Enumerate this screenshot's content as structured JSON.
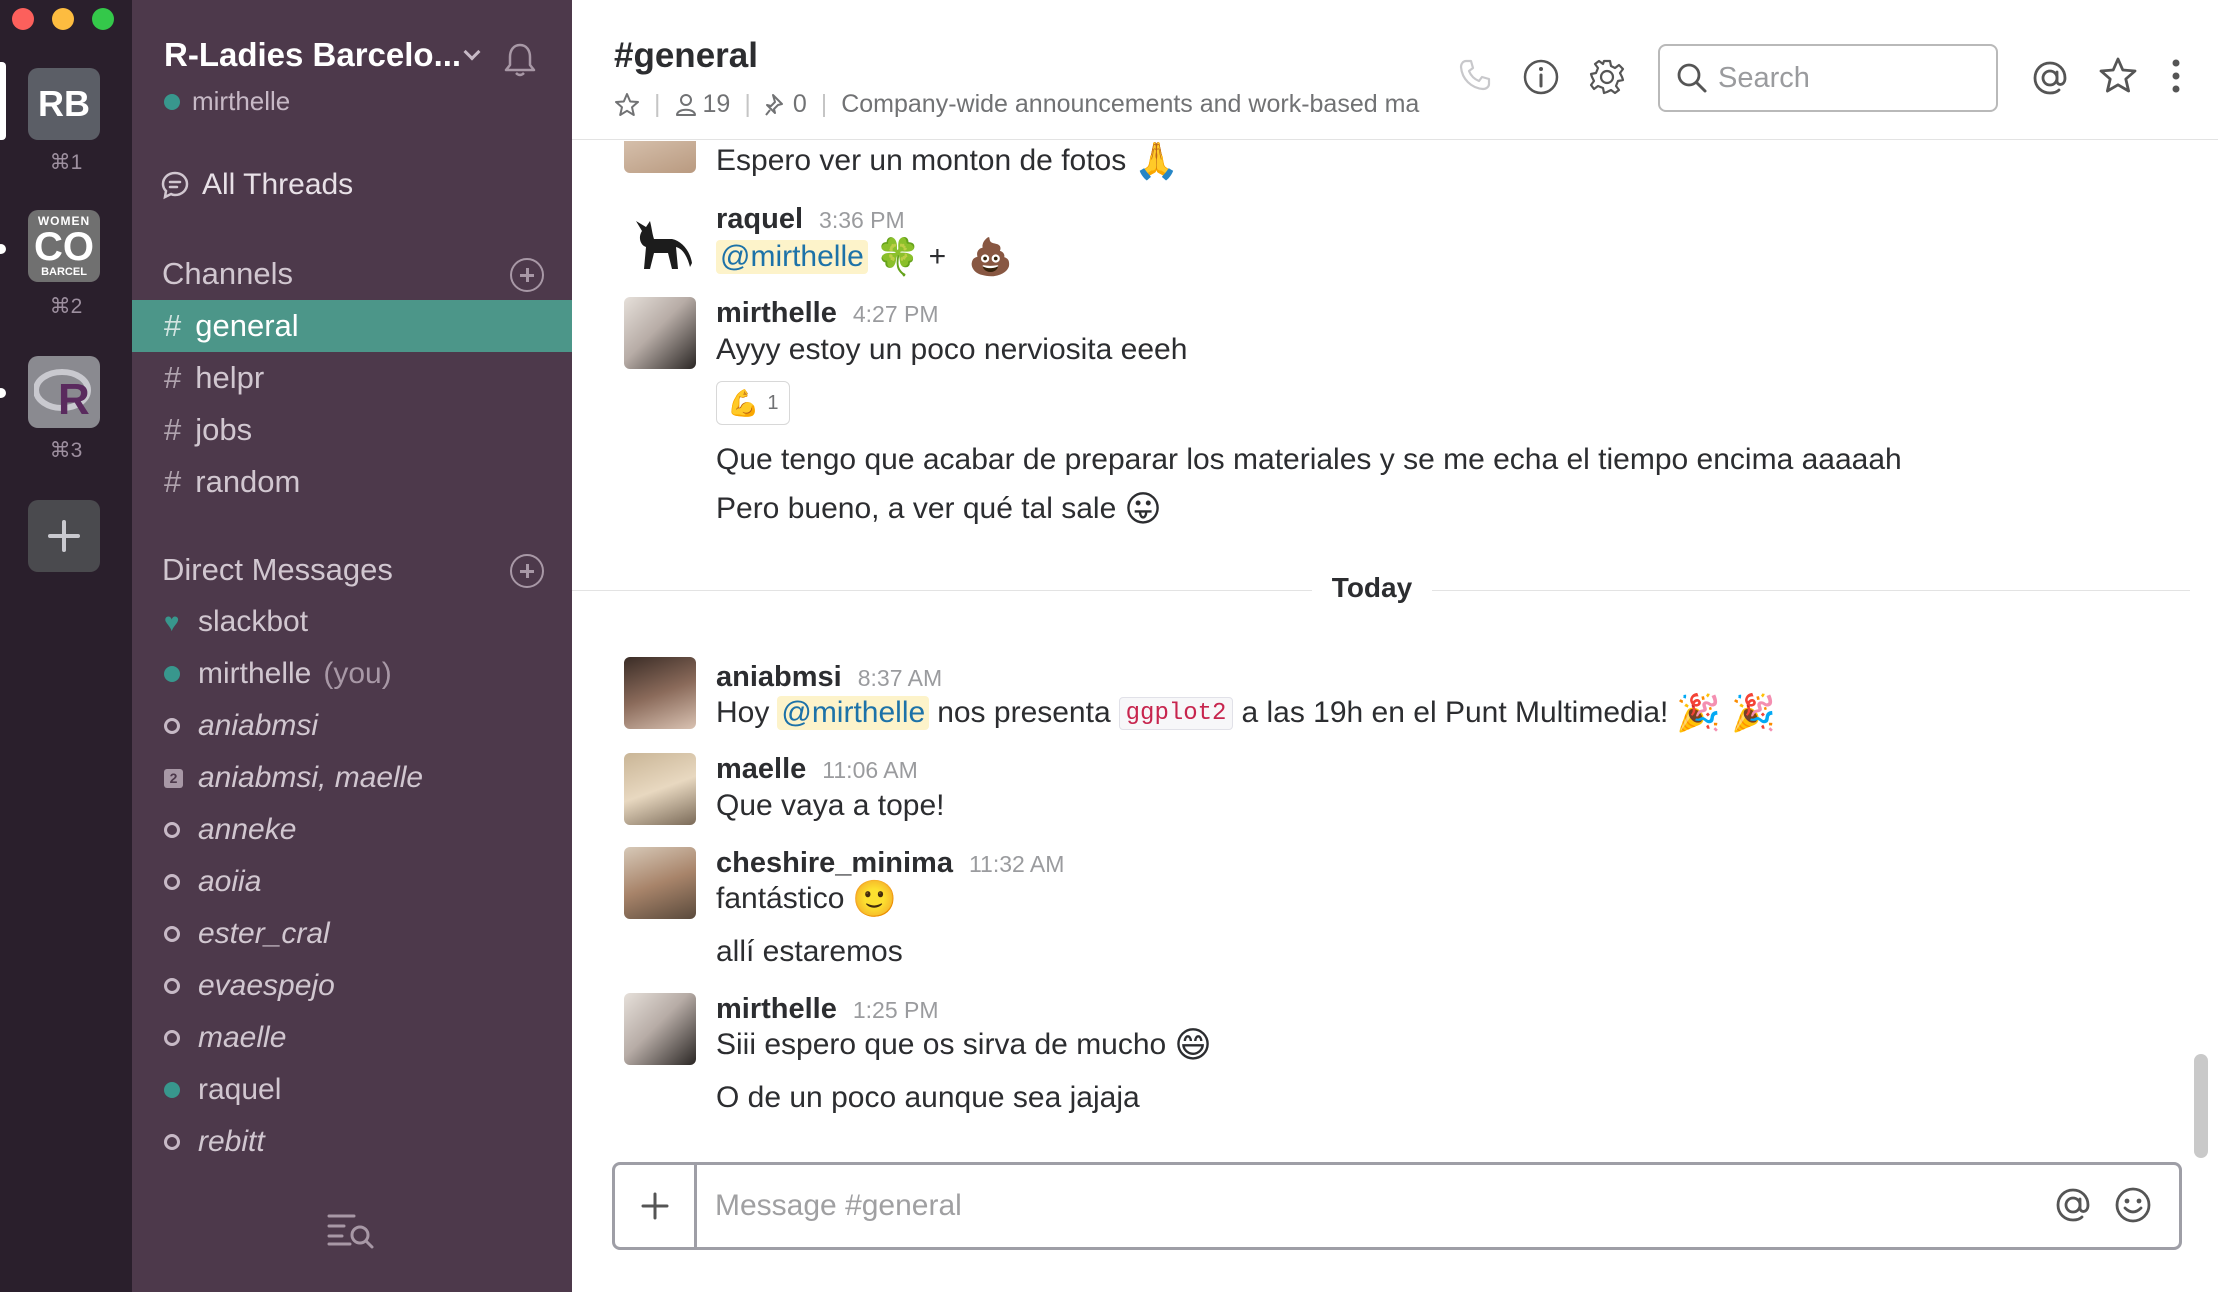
{
  "window": {
    "controls": [
      "close",
      "minimize",
      "zoom"
    ]
  },
  "workspaces": [
    {
      "label": "RB",
      "shortcut": "⌘1",
      "color": "#5b5e66",
      "active": true
    },
    {
      "label": "WOMEN CO BARCEL",
      "shortcut": "⌘2",
      "color": "#6b6b6b",
      "active": false
    },
    {
      "label": "R",
      "shortcut": "⌘3",
      "color": "#8a8a90",
      "active": false
    }
  ],
  "sidebar": {
    "team_name": "R-Ladies Barcelo...",
    "current_user": "mirthelle",
    "all_threads": "All Threads",
    "channels_heading": "Channels",
    "channels": [
      {
        "name": "general",
        "active": true
      },
      {
        "name": "helpr",
        "active": false
      },
      {
        "name": "jobs",
        "active": false
      },
      {
        "name": "random",
        "active": false
      }
    ],
    "dm_heading": "Direct Messages",
    "direct_messages": [
      {
        "name": "slackbot",
        "status": "bot"
      },
      {
        "name": "mirthelle",
        "suffix": "(you)",
        "status": "online"
      },
      {
        "name": "aniabmsi",
        "status": "away"
      },
      {
        "name": "aniabmsi, maelle",
        "status": "group",
        "count": "2"
      },
      {
        "name": "anneke",
        "status": "away"
      },
      {
        "name": "aoiia",
        "status": "away"
      },
      {
        "name": "ester_cral",
        "status": "away"
      },
      {
        "name": "evaespejo",
        "status": "away"
      },
      {
        "name": "maelle",
        "status": "away"
      },
      {
        "name": "raquel",
        "status": "online"
      },
      {
        "name": "rebitt",
        "status": "away"
      }
    ]
  },
  "header": {
    "channel": "#general",
    "members": "19",
    "pinned": "0",
    "topic": "Company-wide announcements and work-based ma",
    "search_placeholder": "Search"
  },
  "messages": {
    "m0": {
      "text": "Espero ver un monton de fotos",
      "emoji": "🙏"
    },
    "m1": {
      "author": "raquel",
      "time": "3:36 PM",
      "mention": "@mirthelle",
      "emoji1": "🍀",
      "plus": "+",
      "emoji2": "💩"
    },
    "m2": {
      "author": "mirthelle",
      "time": "4:27 PM",
      "text": "Ayyy estoy un poco nerviosita eeeh",
      "reaction_emoji": "💪",
      "reaction_count": "1",
      "text2": "Que tengo que acabar de preparar los materiales y se me echa el tiempo encima aaaaah",
      "text3": "Pero bueno, a ver qué tal sale",
      "emoji3": "😛"
    },
    "day_divider": "Today",
    "m3": {
      "author": "aniabmsi",
      "time": "8:37 AM",
      "pre": "Hoy",
      "mention": "@mirthelle",
      "mid": "nos presenta",
      "code": "ggplot2",
      "post": "a las 19h en el Punt Multimedia!",
      "emoji": "🎉 🎉"
    },
    "m4": {
      "author": "maelle",
      "time": "11:06 AM",
      "text": "Que vaya a tope!"
    },
    "m5": {
      "author": "cheshire_minima",
      "time": "11:32 AM",
      "text": "fantástico",
      "emoji": "🙂",
      "text2": "allí estaremos"
    },
    "m6": {
      "author": "mirthelle",
      "time": "1:25 PM",
      "text": "Siii espero que os sirva de mucho",
      "emoji": "😄",
      "text2": "O de un poco aunque sea jajaja"
    }
  },
  "composer": {
    "placeholder": "Message #general"
  },
  "colors": {
    "sidebar": "#4d394b",
    "rail": "#2a1f2c",
    "active_channel": "#4c9689",
    "online": "#38978d",
    "mention_bg": "#fdf3ca"
  }
}
